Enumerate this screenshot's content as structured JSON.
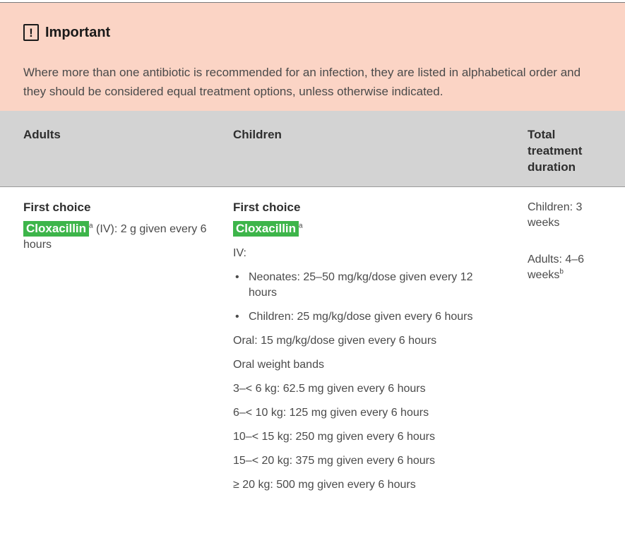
{
  "important": {
    "icon": "exclamation-icon",
    "title": "Important",
    "text": "Where more than one antibiotic is recommended for an infection, they are listed in alphabetical order and they should be considered equal treatment options, unless otherwise indicated."
  },
  "table": {
    "headers": {
      "adults": "Adults",
      "children": "Children",
      "duration": "Total treatment duration"
    },
    "adults": {
      "label": "First choice",
      "drug": "Cloxacillin",
      "drug_sup": "a",
      "dose": " (IV): 2 g given every 6 hours"
    },
    "children": {
      "label": "First choice",
      "drug": "Cloxacillin",
      "drug_sup": "a",
      "iv_label": "IV:",
      "iv_items": [
        "Neonates: 25–50 mg/kg/dose given every 12 hours",
        "Children: 25 mg/kg/dose given every 6 hours"
      ],
      "oral": "Oral: 15 mg/kg/dose given every 6 hours",
      "weight_bands_label": "Oral weight bands",
      "weight_bands": [
        "3–< 6 kg: 62.5 mg given every 6 hours",
        "6–< 10 kg: 125 mg given every 6 hours",
        "10–< 15 kg: 250 mg given every 6 hours",
        "15–< 20 kg: 375 mg given every 6 hours",
        "≥ 20 kg: 500 mg given every 6 hours"
      ]
    },
    "duration": {
      "children": "Children: 3 weeks",
      "adults": "Adults: 4–6 weeks",
      "adults_sup": "b"
    }
  },
  "colors": {
    "important_bg": "#fbd4c5",
    "header_bg": "#d3d3d3",
    "drug_highlight": "#3db54a"
  }
}
